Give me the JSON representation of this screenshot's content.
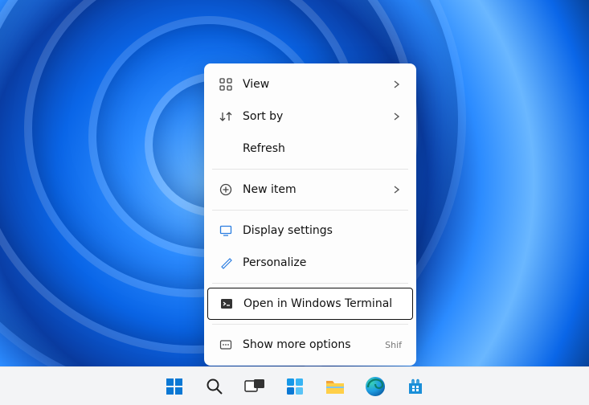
{
  "context_menu": {
    "items": [
      {
        "label": "View",
        "icon": "grid",
        "has_submenu": true,
        "selected": false
      },
      {
        "label": "Sort by",
        "icon": "sort",
        "has_submenu": true,
        "selected": false
      },
      {
        "label": "Refresh",
        "icon": "",
        "has_submenu": false,
        "selected": false
      },
      {
        "sep": true
      },
      {
        "label": "New item",
        "icon": "plus-circle",
        "has_submenu": true,
        "selected": false
      },
      {
        "sep": true
      },
      {
        "label": "Display settings",
        "icon": "monitor",
        "has_submenu": false,
        "selected": false
      },
      {
        "label": "Personalize",
        "icon": "brush",
        "has_submenu": false,
        "selected": false
      },
      {
        "sep": true
      },
      {
        "label": "Open in Windows Terminal",
        "icon": "terminal",
        "has_submenu": false,
        "selected": true
      },
      {
        "sep": true
      },
      {
        "label": "Show more options",
        "icon": "more",
        "has_submenu": false,
        "selected": false,
        "accel": "Shif"
      }
    ]
  },
  "taskbar": {
    "items": [
      {
        "name": "start",
        "type": "start"
      },
      {
        "name": "search",
        "type": "search"
      },
      {
        "name": "task-view",
        "type": "taskview"
      },
      {
        "name": "widgets",
        "type": "widgets"
      },
      {
        "name": "file-explorer",
        "type": "explorer"
      },
      {
        "name": "edge",
        "type": "edge"
      },
      {
        "name": "microsoft-store",
        "type": "store"
      }
    ]
  }
}
